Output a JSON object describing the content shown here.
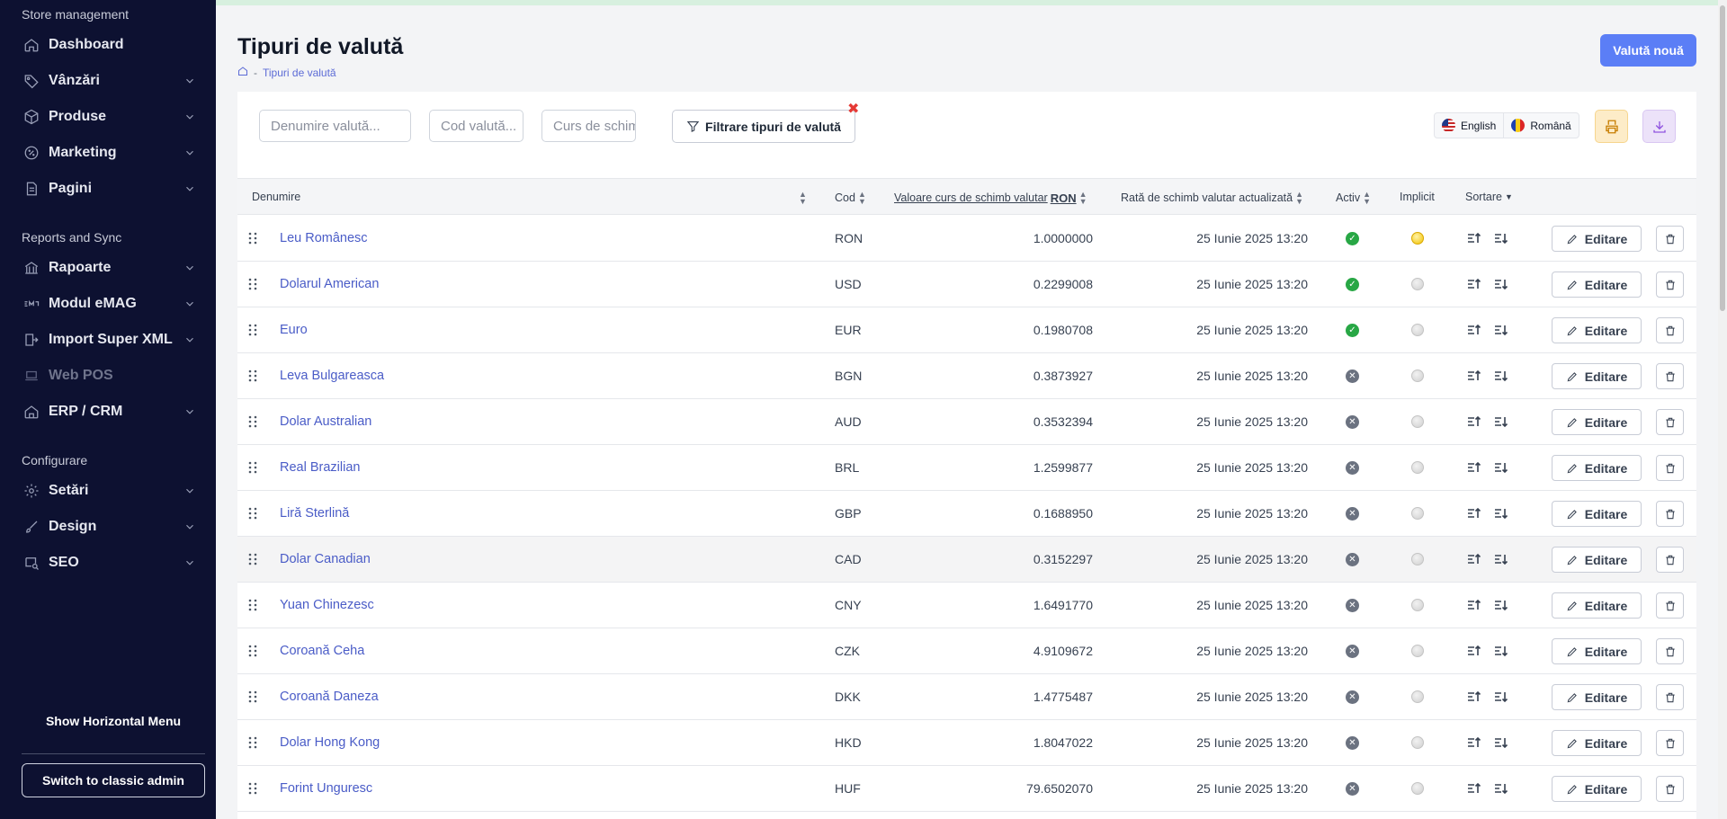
{
  "sidebar": {
    "section1": "Store management",
    "section2": "Reports and Sync",
    "section3": "Configurare",
    "items": [
      {
        "label": "Dashboard"
      },
      {
        "label": "Vânzări"
      },
      {
        "label": "Produse"
      },
      {
        "label": "Marketing"
      },
      {
        "label": "Pagini"
      },
      {
        "label": "Rapoarte"
      },
      {
        "label": "Modul eMAG"
      },
      {
        "label": "Import Super XML"
      },
      {
        "label": "Web POS"
      },
      {
        "label": "ERP / CRM"
      },
      {
        "label": "Setări"
      },
      {
        "label": "Design"
      },
      {
        "label": "SEO"
      }
    ],
    "show_horizontal": "Show Horizontal Menu",
    "switch_classic": "Switch to classic admin"
  },
  "header": {
    "title": "Tipuri de valută",
    "breadcrumb_current": "Tipuri de valută",
    "breadcrumb_sep": "-",
    "new_button": "Valută nouă"
  },
  "filters": {
    "name_placeholder": "Denumire valută...",
    "code_placeholder": "Cod valută...",
    "rate_placeholder": "Curs de schimb",
    "filter_button": "Filtrare tipuri de valută",
    "clear_icon": "close-icon"
  },
  "languages": [
    {
      "label": "English",
      "flag": "us-flag"
    },
    {
      "label": "Română",
      "flag": "ro-flag"
    }
  ],
  "table": {
    "headers": {
      "name": "Denumire",
      "code": "Cod",
      "rate": "Valoare curs de schimb valutar",
      "rate_currency": "RON",
      "updated": "Rată de schimb valutar actualizată",
      "active": "Activ",
      "implicit": "Implicit",
      "sort": "Sortare"
    },
    "edit_label": "Editare",
    "rows": [
      {
        "name": "Leu Românesc",
        "code": "RON",
        "rate": "1.0000000",
        "updated": "25 Iunie 2025 13:20",
        "active": true,
        "default": true
      },
      {
        "name": "Dolarul American",
        "code": "USD",
        "rate": "0.2299008",
        "updated": "25 Iunie 2025 13:20",
        "active": true,
        "default": false
      },
      {
        "name": "Euro",
        "code": "EUR",
        "rate": "0.1980708",
        "updated": "25 Iunie 2025 13:20",
        "active": true,
        "default": false
      },
      {
        "name": "Leva Bulgareasca",
        "code": "BGN",
        "rate": "0.3873927",
        "updated": "25 Iunie 2025 13:20",
        "active": false,
        "default": false
      },
      {
        "name": "Dolar Australian",
        "code": "AUD",
        "rate": "0.3532394",
        "updated": "25 Iunie 2025 13:20",
        "active": false,
        "default": false
      },
      {
        "name": "Real Brazilian",
        "code": "BRL",
        "rate": "1.2599877",
        "updated": "25 Iunie 2025 13:20",
        "active": false,
        "default": false
      },
      {
        "name": "Liră Sterlină",
        "code": "GBP",
        "rate": "0.1688950",
        "updated": "25 Iunie 2025 13:20",
        "active": false,
        "default": false
      },
      {
        "name": "Dolar Canadian",
        "code": "CAD",
        "rate": "0.3152297",
        "updated": "25 Iunie 2025 13:20",
        "active": false,
        "default": false
      },
      {
        "name": "Yuan Chinezesc",
        "code": "CNY",
        "rate": "1.6491770",
        "updated": "25 Iunie 2025 13:20",
        "active": false,
        "default": false
      },
      {
        "name": "Coroană Ceha",
        "code": "CZK",
        "rate": "4.9109672",
        "updated": "25 Iunie 2025 13:20",
        "active": false,
        "default": false
      },
      {
        "name": "Coroană Daneza",
        "code": "DKK",
        "rate": "1.4775487",
        "updated": "25 Iunie 2025 13:20",
        "active": false,
        "default": false
      },
      {
        "name": "Dolar Hong Kong",
        "code": "HKD",
        "rate": "1.8047022",
        "updated": "25 Iunie 2025 13:20",
        "active": false,
        "default": false
      },
      {
        "name": "Forint Unguresc",
        "code": "HUF",
        "rate": "79.6502070",
        "updated": "25 Iunie 2025 13:20",
        "active": false,
        "default": false
      }
    ]
  },
  "colors": {
    "sidebar_bg": "#0d1131",
    "accent": "#5b7ef6",
    "link": "#4a5cc7",
    "active_on": "#28a745",
    "active_off": "#6b7280"
  }
}
